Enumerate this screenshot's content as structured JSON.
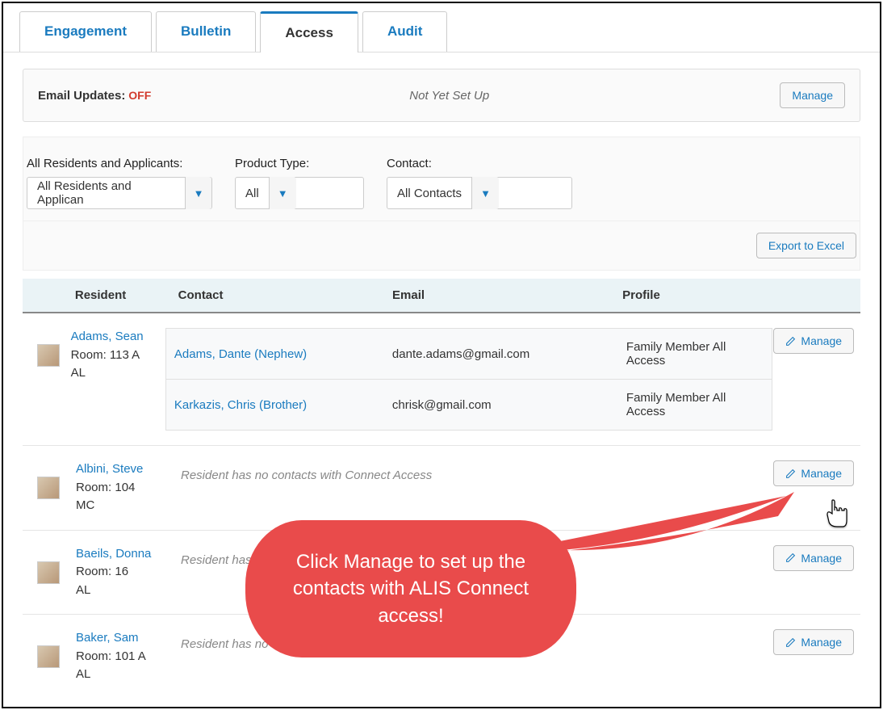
{
  "tabs": [
    "Engagement",
    "Bulletin",
    "Access",
    "Audit"
  ],
  "active_tab": "Access",
  "email_updates": {
    "label": "Email Updates:",
    "status": "OFF",
    "note": "Not Yet Set Up",
    "manage": "Manage"
  },
  "filters": {
    "residents": {
      "label": "All Residents and Applicants:",
      "value": "All Residents and Applican"
    },
    "product": {
      "label": "Product Type:",
      "value": "All"
    },
    "contact": {
      "label": "Contact:",
      "value": "All Contacts"
    }
  },
  "export_label": "Export to Excel",
  "headers": {
    "resident": "Resident",
    "contact": "Contact",
    "email": "Email",
    "profile": "Profile"
  },
  "manage_label": "Manage",
  "no_contacts_msg": "Resident has no contacts with Connect Access",
  "residents": [
    {
      "name": "Adams, Sean",
      "room": "Room: 113 A",
      "unit": "AL",
      "contacts": [
        {
          "name": "Adams, Dante (Nephew)",
          "email": "dante.adams@gmail.com",
          "profile": "Family Member All Access"
        },
        {
          "name": "Karkazis, Chris (Brother)",
          "email": "chrisk@gmail.com",
          "profile": "Family Member All Access"
        }
      ]
    },
    {
      "name": "Albini, Steve",
      "room": "Room: 104",
      "unit": "MC",
      "contacts": []
    },
    {
      "name": "Baeils, Donna",
      "room": "Room: 16",
      "unit": "AL",
      "contacts": []
    },
    {
      "name": "Baker, Sam",
      "room": "Room: 101 A",
      "unit": "AL",
      "contacts": []
    }
  ],
  "callout": "Click Manage to set up the contacts with ALIS Connect access!"
}
